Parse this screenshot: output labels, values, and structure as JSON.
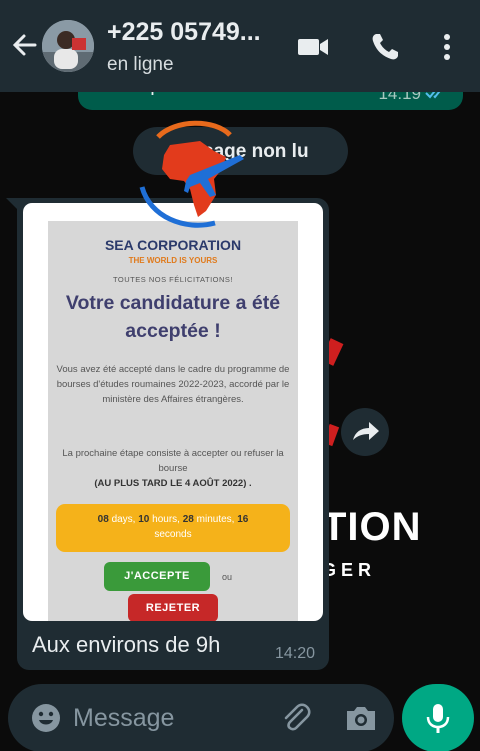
{
  "header": {
    "contact_name": "+225 05749...",
    "status": "en ligne"
  },
  "previous_message": {
    "text": "d'acception !",
    "time": "14:19"
  },
  "unread_banner": {
    "text": "sage non lu"
  },
  "message": {
    "caption": "Aux environs de 9h",
    "time": "14:20",
    "image": {
      "brand": "SEA CORPORATION",
      "tagline": "THE WORLD IS YOURS",
      "congrats": "TOUTES NOS FÉLICITATIONS!",
      "headline": "Votre candidature a été acceptée !",
      "body": "Vous avez été accepté dans le cadre du programme de bourses d'études roumaines 2022-2023, accordé par le ministère des Affaires étrangères.",
      "next_step": "La prochaine étape consiste à accepter ou refuser la bourse",
      "deadline": "(AU PLUS TARD LE 4 AOÛT 2022) .",
      "countdown": {
        "days_value": "08",
        "days_label": "days,",
        "hours_value": "10",
        "hours_label": "hours,",
        "minutes_value": "28",
        "minutes_label": "minutes,",
        "seconds_value": "16",
        "seconds_label": "seconds"
      },
      "accept_label": "J'ACCEPTE",
      "or_label": "ou",
      "reject_label": "REJETER"
    }
  },
  "background_branding": {
    "text": "TION",
    "subtext": "GER"
  },
  "input": {
    "placeholder": "Message"
  },
  "colors": {
    "header_bg": "#1f2c33",
    "sent_bubble": "#005c4b",
    "accent_green": "#00a884",
    "countdown_bg": "#f5b21a",
    "accept_green": "#3a9a3a",
    "reject_red": "#c62828"
  }
}
